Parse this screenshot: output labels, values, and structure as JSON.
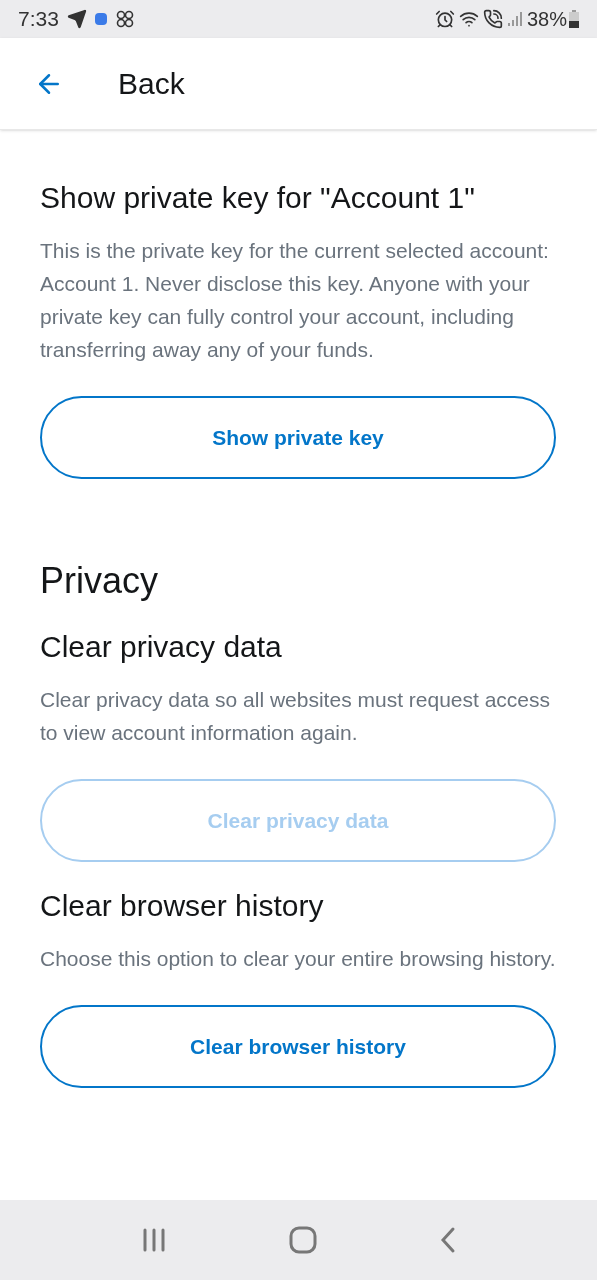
{
  "status_bar": {
    "time": "7:33",
    "battery": "38%"
  },
  "header": {
    "back_label": "Back"
  },
  "sections": [
    {
      "kind": "subsection",
      "title": "Show private key for \"Account 1\"",
      "description": "This is the private key for the current selected account: Account 1. Never disclose this key. Anyone with your private key can fully control your account, including transferring away any of your funds.",
      "button": {
        "label": "Show private key",
        "disabled": false
      }
    },
    {
      "kind": "heading",
      "title": "Privacy"
    },
    {
      "kind": "subsection",
      "title": "Clear privacy data",
      "description": "Clear privacy data so all websites must request access to view account information again.",
      "button": {
        "label": "Clear privacy data",
        "disabled": true
      }
    },
    {
      "kind": "subsection",
      "title": "Clear browser history",
      "description": "Choose this option to clear your entire browsing history.",
      "button": {
        "label": "Clear browser history",
        "disabled": false
      }
    }
  ]
}
